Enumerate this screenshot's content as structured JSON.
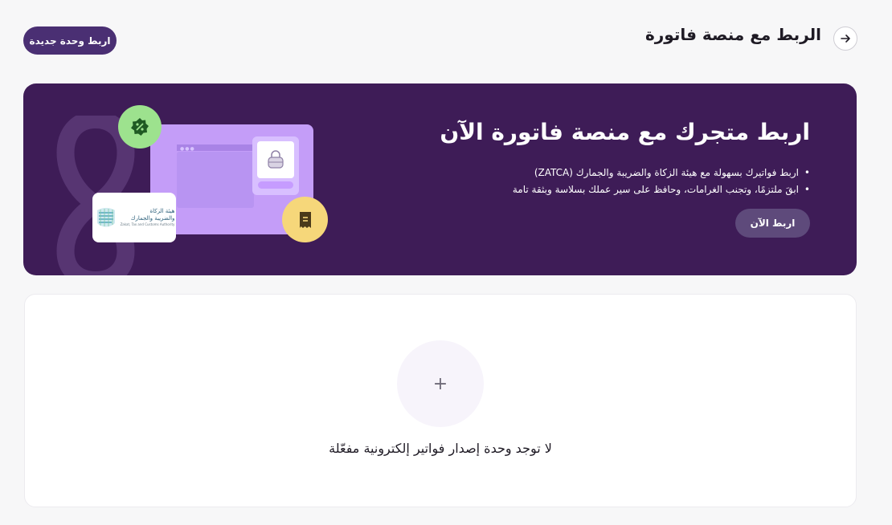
{
  "header": {
    "title": "الربط مع منصة فاتورة",
    "new_unit_label": "اربط وحدة جديدة"
  },
  "banner": {
    "title": "اربط متجرك مع منصة فاتورة الآن",
    "bullets": [
      "اربط فواتيرك بسهولة مع هيئة الزكاة والضريبة والجمارك (ZATCA)",
      "ابقَ ملتزمًا، وتجنب الغرامات، وحافظ على سير عملك بسلاسة وبثقة تامة"
    ],
    "cta_label": "اربط الآن",
    "zatca_logo": {
      "line1": "هيئة الزكاة",
      "line2": "والضريبة والجمارك",
      "line3": "Zakat, Tax and Customs Authority"
    }
  },
  "empty_state": {
    "add_symbol": "+",
    "message": "لا توجد وحدة إصدار فواتير إلكترونية مفعّلة"
  },
  "colors": {
    "primary": "#4a2f73",
    "banner_bg": "#3e1c57",
    "page_bg": "#f7f7f8"
  }
}
